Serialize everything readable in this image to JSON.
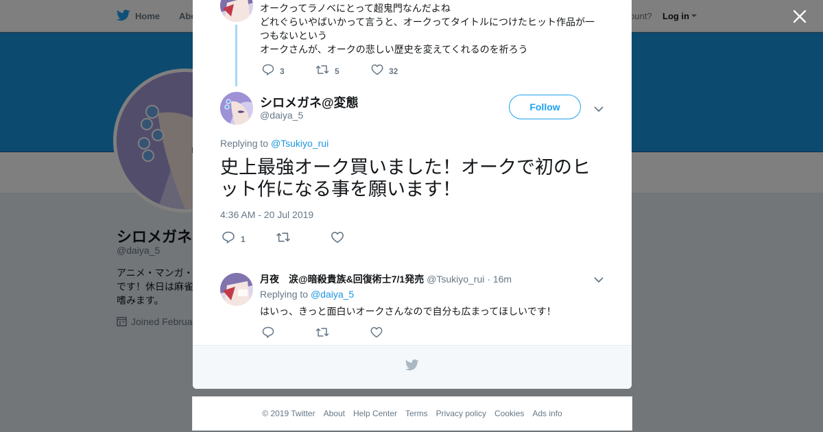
{
  "topbar": {
    "home": "Home",
    "about": "Abo",
    "have_account": "ccount?",
    "login": "Log in"
  },
  "profile": {
    "name": "シロメガネ",
    "handle": "@daiya_5",
    "bio_lines": [
      "アニメ・マンガ・",
      "です！休日は麻雀",
      "嗜みます。"
    ],
    "joined": "Joined Februa"
  },
  "colors": {
    "accent": "#1da1f2",
    "banner": "#1b95e0",
    "thread_line": "#a5d7f7"
  },
  "parent_tweet": {
    "lines": [
      "オークってラノベにとって超鬼門なんだよね",
      "どれぐらいやばいかって言うと、オークってタイトルにつけたヒット作品が一",
      "つもないという",
      "オークさんが、オークの悲しい歴史を変えてくれるのを祈ろう"
    ],
    "replies": "3",
    "retweets": "5",
    "likes": "32"
  },
  "main_tweet": {
    "name": "シロメガネ@変態",
    "handle": "@daiya_5",
    "follow_label": "Follow",
    "replying_to_prefix": "Replying to",
    "replying_to": "@Tsukiyo_rui",
    "text_lines": [
      "史上最強オーク買いました！オークで初のヒ",
      "ット作になる事を願います！"
    ],
    "timestamp": "4:36 AM - 20 Jul 2019",
    "replies": "1"
  },
  "reply_tweet": {
    "name": "月夜　涙@暗殺貴族&回復術士7/1発売",
    "handle": "@Tsukiyo_rui",
    "time": "· 16m",
    "replying_to_prefix": "Replying to",
    "replying_to": "@daiya_5",
    "text": "はいっ、きっと面白いオークさんなので自分も広まってほしいです！"
  },
  "footer": {
    "copyright": "© 2019 Twitter",
    "links": [
      "About",
      "Help Center",
      "Terms",
      "Privacy policy",
      "Cookies",
      "Ads info"
    ]
  }
}
